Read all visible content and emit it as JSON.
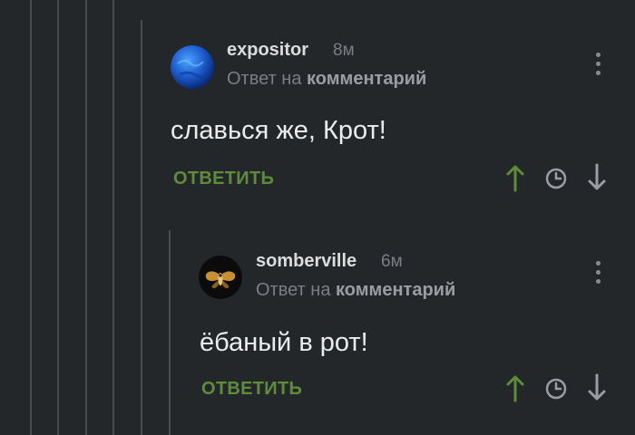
{
  "comments": [
    {
      "author": "expositor",
      "time": "8м",
      "reply_prefix": "Ответ на ",
      "reply_target": "комментарий",
      "text": "славься же, Крот!",
      "reply_label": "ОТВЕТИТЬ",
      "avatar_icon": "blue-planet-avatar"
    },
    {
      "author": "somberville",
      "time": "6м",
      "reply_prefix": "Ответ на ",
      "reply_target": "комментарий",
      "text": "ёбаный в рот!",
      "reply_label": "ОТВЕТИТЬ",
      "avatar_icon": "moth-avatar"
    }
  ],
  "colors": {
    "background": "#24272a",
    "thread_line": "#484c50",
    "reply_button": "#5f8c3a",
    "upvote": "#5f8c3a",
    "muted": "#7b7f83"
  },
  "icons": [
    "menu-dots-icon",
    "upvote-arrow-icon",
    "clock-icon",
    "downvote-arrow-icon"
  ]
}
